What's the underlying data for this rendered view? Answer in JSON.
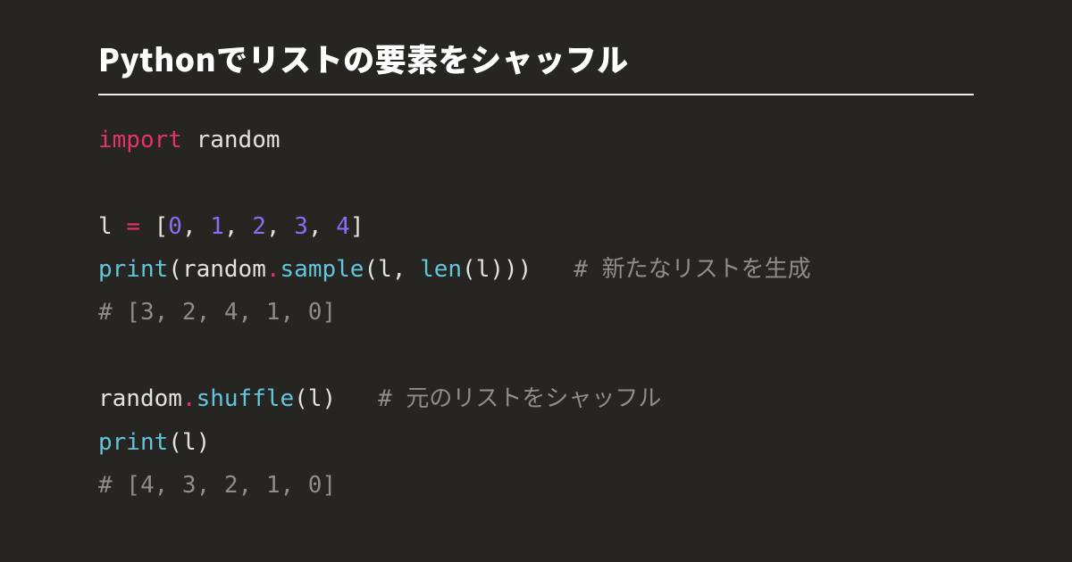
{
  "title": "Pythonでリストの要素をシャッフル",
  "code": {
    "l1": {
      "kw": "import",
      "sp1": " ",
      "mod": "random"
    },
    "blank1": "",
    "l3": {
      "var": "l ",
      "op": "=",
      "sp": " ",
      "lb": "[",
      "n0": "0",
      "c0": ", ",
      "n1": "1",
      "c1": ", ",
      "n2": "2",
      "c2": ", ",
      "n3": "3",
      "c3": ", ",
      "n4": "4",
      "rb": "]"
    },
    "l4": {
      "fn1": "print",
      "lp1": "(",
      "mod": "random",
      "dot": ".",
      "fn2": "sample",
      "lp2": "(",
      "arg1": "l",
      "c": ", ",
      "fn3": "len",
      "lp3": "(",
      "arg2": "l",
      "rp3": ")",
      "rp2": ")",
      "rp1": ")",
      "pad": "   ",
      "cmt": "# 新たなリストを生成"
    },
    "l5": {
      "cmt": "# [3, 2, 4, 1, 0]"
    },
    "blank2": "",
    "l7": {
      "mod": "random",
      "dot": ".",
      "fn": "shuffle",
      "lp": "(",
      "arg": "l",
      "rp": ")",
      "pad": "   ",
      "cmt": "# 元のリストをシャッフル"
    },
    "l8": {
      "fn": "print",
      "lp": "(",
      "arg": "l",
      "rp": ")"
    },
    "l9": {
      "cmt": "# [4, 3, 2, 1, 0]"
    }
  }
}
